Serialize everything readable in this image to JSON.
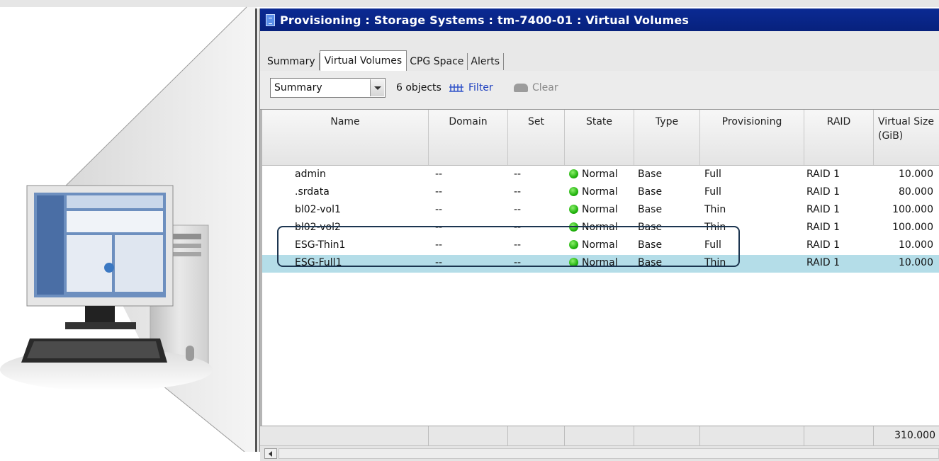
{
  "window": {
    "title": "Provisioning : Storage Systems : tm-7400-01 : Virtual Volumes"
  },
  "tabs": [
    {
      "label": "Summary",
      "active": false
    },
    {
      "label": "Virtual Volumes",
      "active": true
    },
    {
      "label": "CPG Space",
      "active": false
    },
    {
      "label": "Alerts",
      "active": false
    }
  ],
  "toolbar": {
    "view_select_value": "Summary",
    "object_count": "6 objects",
    "filter_label": "Filter",
    "clear_label": "Clear"
  },
  "table": {
    "columns": [
      "Name",
      "Domain",
      "Set",
      "State",
      "Type",
      "Provisioning",
      "RAID",
      "Virtual Size (GiB)"
    ],
    "rows": [
      {
        "name": "admin",
        "domain": "--",
        "set": "--",
        "state": "Normal",
        "type": "Base",
        "provisioning": "Full",
        "raid": "RAID 1",
        "size": "10.000"
      },
      {
        "name": ".srdata",
        "domain": "--",
        "set": "--",
        "state": "Normal",
        "type": "Base",
        "provisioning": "Full",
        "raid": "RAID 1",
        "size": "80.000"
      },
      {
        "name": "bl02-vol1",
        "domain": "--",
        "set": "--",
        "state": "Normal",
        "type": "Base",
        "provisioning": "Thin",
        "raid": "RAID 1",
        "size": "100.000"
      },
      {
        "name": "bl02-vol2",
        "domain": "--",
        "set": "--",
        "state": "Normal",
        "type": "Base",
        "provisioning": "Thin",
        "raid": "RAID 1",
        "size": "100.000"
      },
      {
        "name": "ESG-Thin1",
        "domain": "--",
        "set": "--",
        "state": "Normal",
        "type": "Base",
        "provisioning": "Full",
        "raid": "RAID 1",
        "size": "10.000"
      },
      {
        "name": "ESG-Full1",
        "domain": "--",
        "set": "--",
        "state": "Normal",
        "type": "Base",
        "provisioning": "Thin",
        "raid": "RAID 1",
        "size": "10.000"
      }
    ],
    "selected_row": 5,
    "highlighted_rows": [
      4,
      5
    ],
    "total_size": "310.000"
  },
  "colors": {
    "titlebar": "#07217d",
    "selected_row": "#b4dde8",
    "state_normal": "#22b30e",
    "highlight_box": "#1c3550"
  },
  "icons": {
    "title": "window-app-icon",
    "filter": "filter-icon",
    "clear": "clear-icon",
    "state": "status-dot-icon",
    "dropdown": "chevron-down-icon",
    "scroll_left": "scroll-left-icon"
  }
}
